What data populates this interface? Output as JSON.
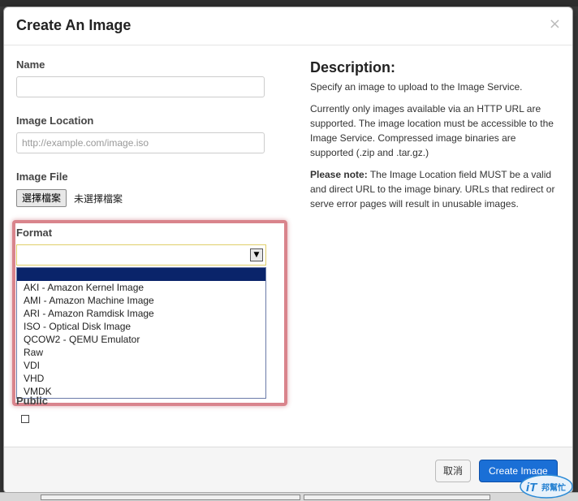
{
  "modal": {
    "title": "Create An Image",
    "close_glyph": "×"
  },
  "form": {
    "name": {
      "label": "Name",
      "value": "",
      "placeholder": ""
    },
    "image_location": {
      "label": "Image Location",
      "value": "",
      "placeholder": "http://example.com/image.iso"
    },
    "image_file": {
      "label": "Image File",
      "button_label": "選擇檔案",
      "status": "未選擇檔案"
    },
    "format": {
      "label": "Format",
      "selected": "",
      "arrow_glyph": "▼",
      "options": [
        "",
        "AKI - Amazon Kernel Image",
        "AMI - Amazon Machine Image",
        "ARI - Amazon Ramdisk Image",
        "ISO - Optical Disk Image",
        "QCOW2 - QEMU Emulator",
        "Raw",
        "VDI",
        "VHD",
        "VMDK"
      ]
    },
    "public": {
      "label": "Public",
      "checked": false
    }
  },
  "description": {
    "title": "Description:",
    "p1": "Specify an image to upload to the Image Service.",
    "p2": "Currently only images available via an HTTP URL are supported. The image location must be accessible to the Image Service. Compressed image binaries are supported (.zip and .tar.gz.)",
    "note_label": "Please note:",
    "note_text": " The Image Location field MUST be a valid and direct URL to the image binary. URLs that redirect or serve error pages will result in unusable images."
  },
  "footer": {
    "cancel_label": "取消",
    "submit_label": "Create Image"
  },
  "colors": {
    "primary_button": "#1a6fd6",
    "highlight_border": "#d9848c",
    "selected_option": "#0a246a"
  },
  "watermark": {
    "text": "iT邦幫忙"
  }
}
